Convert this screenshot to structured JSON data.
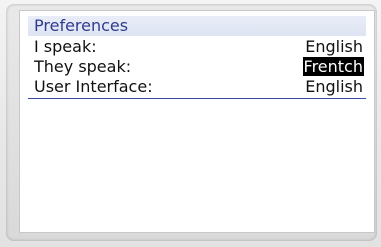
{
  "screen": {
    "title": "Preferences",
    "rows": [
      {
        "label": "I speak:",
        "value": "English",
        "selected": false
      },
      {
        "label": "They speak:",
        "value": "Frentch",
        "selected": true
      },
      {
        "label": "User Interface:",
        "value": "English",
        "selected": false
      }
    ]
  },
  "colors": {
    "title_text": "#2e3c8c",
    "title_bg": "#e4e8f6",
    "divider": "#3a4aa8",
    "selection_bg": "#000000",
    "selection_text": "#ffffff"
  }
}
